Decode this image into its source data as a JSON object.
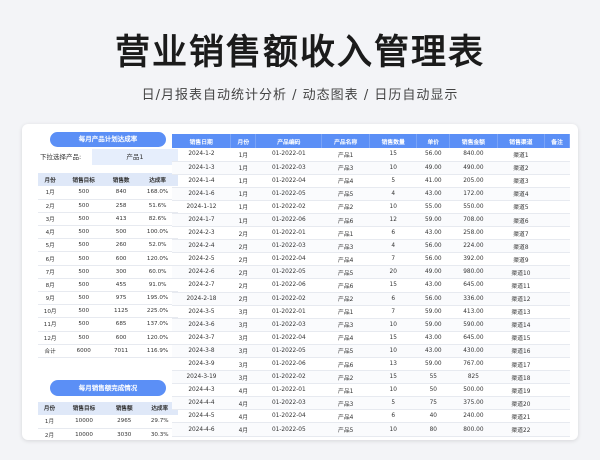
{
  "title": "营业销售额收入管理表",
  "subtitle": "日/月报表自动统计分析  /  动态图表  /  日历自动显示",
  "left": {
    "pill1": "每月产品计划达成率",
    "select_label": "下拉选择产品:",
    "select_value": "产品1",
    "mini_headers": [
      "月份",
      "销售目标",
      "销售数",
      "达成率"
    ],
    "mini_rows": [
      [
        "1月",
        "500",
        "840",
        "168.0%"
      ],
      [
        "2月",
        "500",
        "258",
        "51.6%"
      ],
      [
        "3月",
        "500",
        "413",
        "82.6%"
      ],
      [
        "4月",
        "500",
        "500",
        "100.0%"
      ],
      [
        "5月",
        "500",
        "260",
        "52.0%"
      ],
      [
        "6月",
        "500",
        "600",
        "120.0%"
      ],
      [
        "7月",
        "500",
        "300",
        "60.0%"
      ],
      [
        "8月",
        "500",
        "455",
        "91.0%"
      ],
      [
        "9月",
        "500",
        "975",
        "195.0%"
      ],
      [
        "10月",
        "500",
        "1125",
        "225.0%"
      ],
      [
        "11月",
        "500",
        "685",
        "137.0%"
      ],
      [
        "12月",
        "500",
        "600",
        "120.0%"
      ],
      [
        "合计",
        "6000",
        "7011",
        "116.9%"
      ]
    ],
    "pill2": "每月销售额完成情况",
    "mini2_headers": [
      "月份",
      "销售目标",
      "销售额",
      "达成率"
    ],
    "mini2_rows": [
      [
        "1月",
        "10000",
        "2965",
        "29.7%"
      ],
      [
        "2月",
        "10000",
        "3030",
        "30.3%"
      ]
    ]
  },
  "table": {
    "headers": [
      "销售日期",
      "月份",
      "产品编码",
      "产品名称",
      "销售数量",
      "单价",
      "销售金额",
      "销售渠道",
      "备注"
    ],
    "rows": [
      [
        "2024-1-2",
        "1月",
        "01-2022-01",
        "产品1",
        "15",
        "56.00",
        "840.00",
        "渠道1",
        ""
      ],
      [
        "2024-1-3",
        "1月",
        "01-2022-03",
        "产品3",
        "10",
        "49.00",
        "490.00",
        "渠道2",
        ""
      ],
      [
        "2024-1-4",
        "1月",
        "01-2022-04",
        "产品4",
        "5",
        "41.00",
        "205.00",
        "渠道3",
        ""
      ],
      [
        "2024-1-6",
        "1月",
        "01-2022-05",
        "产品5",
        "4",
        "43.00",
        "172.00",
        "渠道4",
        ""
      ],
      [
        "2024-1-12",
        "1月",
        "01-2022-02",
        "产品2",
        "10",
        "55.00",
        "550.00",
        "渠道5",
        ""
      ],
      [
        "2024-1-7",
        "1月",
        "01-2022-06",
        "产品6",
        "12",
        "59.00",
        "708.00",
        "渠道6",
        ""
      ],
      [
        "2024-2-3",
        "2月",
        "01-2022-01",
        "产品1",
        "6",
        "43.00",
        "258.00",
        "渠道7",
        ""
      ],
      [
        "2024-2-4",
        "2月",
        "01-2022-03",
        "产品3",
        "4",
        "56.00",
        "224.00",
        "渠道8",
        ""
      ],
      [
        "2024-2-5",
        "2月",
        "01-2022-04",
        "产品4",
        "7",
        "56.00",
        "392.00",
        "渠道9",
        ""
      ],
      [
        "2024-2-6",
        "2月",
        "01-2022-05",
        "产品5",
        "20",
        "49.00",
        "980.00",
        "渠道10",
        ""
      ],
      [
        "2024-2-7",
        "2月",
        "01-2022-06",
        "产品6",
        "15",
        "43.00",
        "645.00",
        "渠道11",
        ""
      ],
      [
        "2024-2-18",
        "2月",
        "01-2022-02",
        "产品2",
        "6",
        "56.00",
        "336.00",
        "渠道12",
        ""
      ],
      [
        "2024-3-5",
        "3月",
        "01-2022-01",
        "产品1",
        "7",
        "59.00",
        "413.00",
        "渠道13",
        ""
      ],
      [
        "2024-3-6",
        "3月",
        "01-2022-03",
        "产品3",
        "10",
        "59.00",
        "590.00",
        "渠道14",
        ""
      ],
      [
        "2024-3-7",
        "3月",
        "01-2022-04",
        "产品4",
        "15",
        "43.00",
        "645.00",
        "渠道15",
        ""
      ],
      [
        "2024-3-8",
        "3月",
        "01-2022-05",
        "产品5",
        "10",
        "43.00",
        "430.00",
        "渠道16",
        ""
      ],
      [
        "2024-3-9",
        "3月",
        "01-2022-06",
        "产品6",
        "13",
        "59.00",
        "767.00",
        "渠道17",
        ""
      ],
      [
        "2024-3-19",
        "3月",
        "01-2022-02",
        "产品2",
        "15",
        "55",
        "825",
        "渠道18",
        ""
      ],
      [
        "2024-4-3",
        "4月",
        "01-2022-01",
        "产品1",
        "10",
        "50",
        "500.00",
        "渠道19",
        ""
      ],
      [
        "2024-4-4",
        "4月",
        "01-2022-03",
        "产品3",
        "5",
        "75",
        "375.00",
        "渠道20",
        ""
      ],
      [
        "2024-4-5",
        "4月",
        "01-2022-04",
        "产品4",
        "6",
        "40",
        "240.00",
        "渠道21",
        ""
      ],
      [
        "2024-4-6",
        "4月",
        "01-2022-05",
        "产品5",
        "10",
        "80",
        "800.00",
        "渠道22",
        ""
      ]
    ]
  }
}
